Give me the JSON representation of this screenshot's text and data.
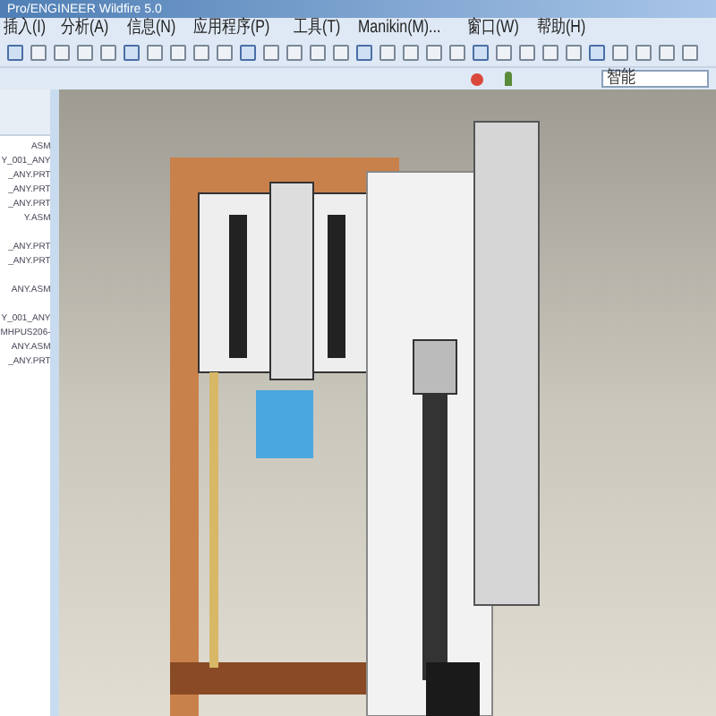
{
  "window": {
    "title": "Pro/ENGINEER Wildfire 5.0"
  },
  "menu": [
    "插入(I)",
    "分析(A)",
    "信息(N)",
    "应用程序(P)",
    "工具(T)",
    "Manikin(M)...",
    "窗口(W)",
    "帮助(H)"
  ],
  "filter": {
    "value": "智能"
  },
  "tree": {
    "groups": [
      [
        "ASM",
        "Y_001_ANY",
        "_ANY.PRT",
        "_ANY.PRT",
        "_ANY.PRT",
        "Y.ASM"
      ],
      [
        "_ANY.PRT",
        "_ANY.PRT"
      ],
      [
        "ANY.ASM"
      ],
      [
        "Y_001_ANY",
        "MHPUS206-",
        "ANY.ASM",
        "_ANY.PRT"
      ]
    ]
  }
}
